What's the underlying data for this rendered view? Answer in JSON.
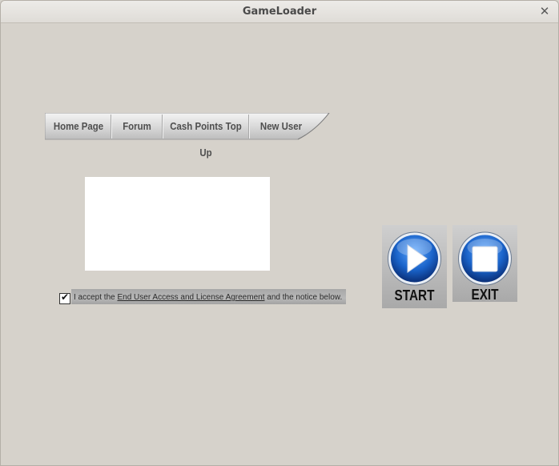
{
  "window": {
    "title": "GameLoader"
  },
  "nav": {
    "items": [
      {
        "label": "Home Page"
      },
      {
        "label": "Forum"
      },
      {
        "label": "Cash Points Top Up"
      },
      {
        "label": "New User"
      }
    ]
  },
  "agreement": {
    "checked": true,
    "prefix": "I accept the ",
    "link": "End User Access and License Agreement",
    "suffix": " and the notice below."
  },
  "buttons": {
    "start_label": "START",
    "exit_label": "EXIT"
  },
  "colors": {
    "window_bg": "#d6d2cb",
    "button_blue": "#1a63c9"
  }
}
